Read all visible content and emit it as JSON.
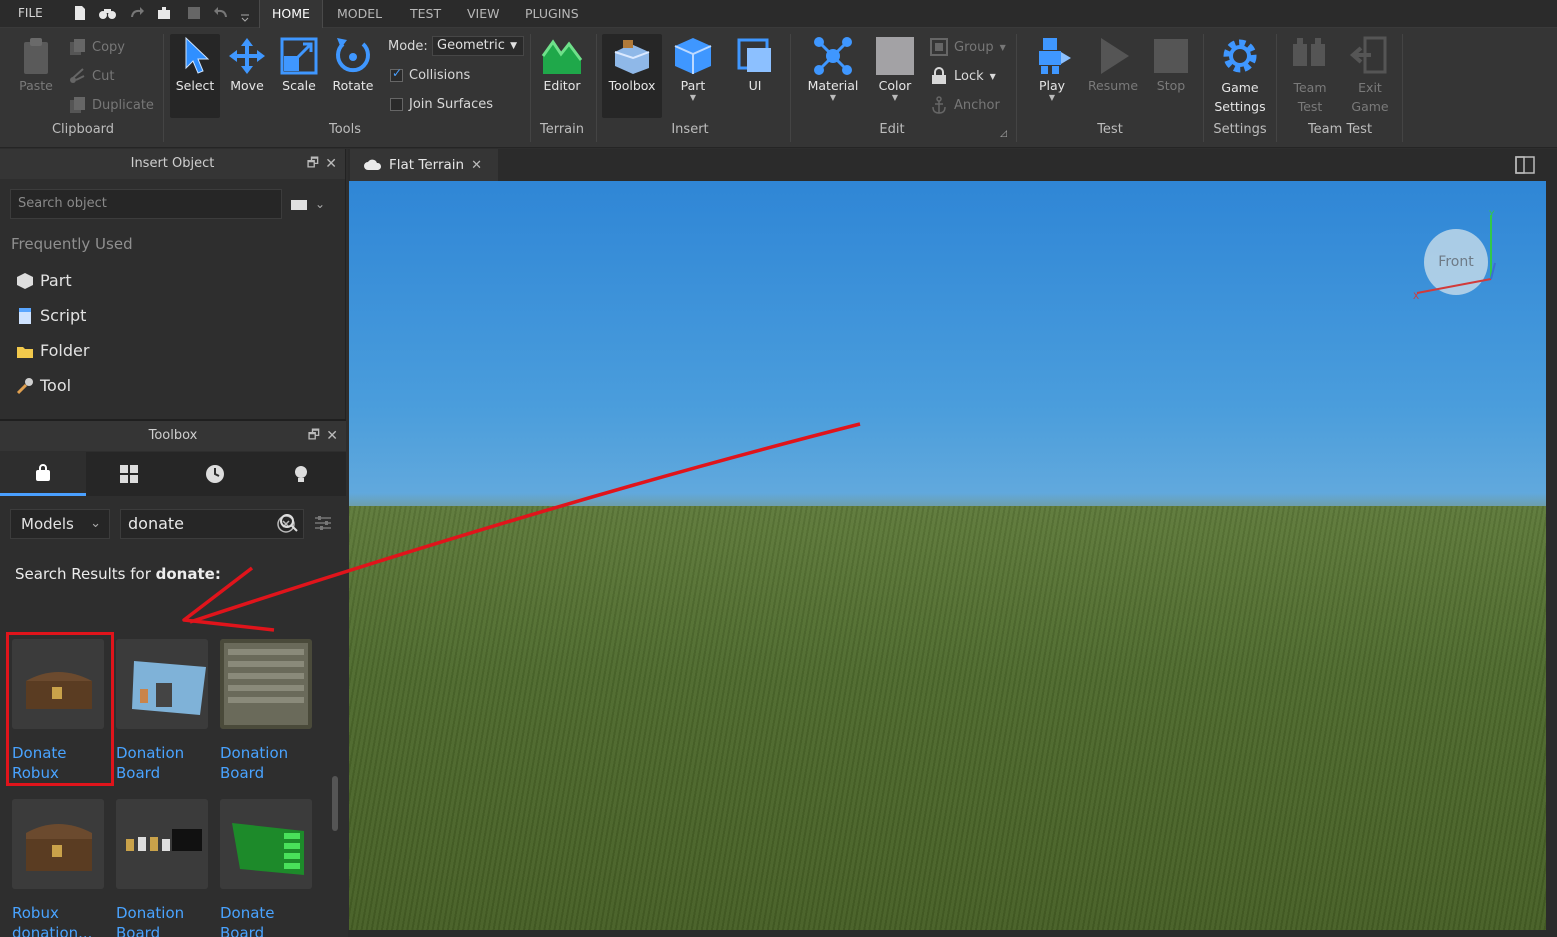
{
  "menu": {
    "file": "FILE",
    "tabs": [
      "HOME",
      "MODEL",
      "TEST",
      "VIEW",
      "PLUGINS"
    ]
  },
  "ribbon": {
    "clipboard": {
      "paste": "Paste",
      "copy": "Copy",
      "cut": "Cut",
      "duplicate": "Duplicate",
      "group_label": "Clipboard"
    },
    "tools": {
      "select": "Select",
      "move": "Move",
      "scale": "Scale",
      "rotate": "Rotate",
      "mode_label": "Mode:",
      "mode_value": "Geometric",
      "collisions": "Collisions",
      "join_surfaces": "Join Surfaces",
      "group_label": "Tools"
    },
    "terrain": {
      "editor": "Editor",
      "group_label": "Terrain"
    },
    "insert": {
      "toolbox": "Toolbox",
      "part": "Part",
      "ui": "UI",
      "group_label": "Insert"
    },
    "edit": {
      "material": "Material",
      "color": "Color",
      "group": "Group",
      "lock": "Lock",
      "anchor": "Anchor",
      "group_label": "Edit"
    },
    "test": {
      "play": "Play",
      "resume": "Resume",
      "stop": "Stop",
      "group_label": "Test"
    },
    "settings": {
      "game_settings_1": "Game",
      "game_settings_2": "Settings",
      "group_label": "Settings"
    },
    "team_test": {
      "team_1": "Team",
      "team_2": "Test",
      "exit_1": "Exit",
      "exit_2": "Game",
      "group_label": "Team Test"
    }
  },
  "insert_object": {
    "title": "Insert Object",
    "search_placeholder": "Search object",
    "frequently_used": "Frequently Used",
    "items": [
      "Part",
      "Script",
      "Folder",
      "Tool"
    ]
  },
  "toolbox": {
    "title": "Toolbox",
    "category": "Models",
    "search_value": "donate",
    "results_prefix": "Search Results for",
    "results_query": "donate:",
    "results": [
      {
        "label": "Donate\nRobux"
      },
      {
        "label": "Donation\nBoard"
      },
      {
        "label": "Donation\nBoard"
      },
      {
        "label": "Robux\ndonation..."
      },
      {
        "label": "Donation\nBoard"
      },
      {
        "label": "Donate\nBoard"
      }
    ]
  },
  "document": {
    "tab_title": "Flat Terrain",
    "viewcube_label": "Front"
  },
  "colors": {
    "accent": "#4aa0ff",
    "highlight_red": "#e0141b",
    "link": "#49a3ff"
  }
}
